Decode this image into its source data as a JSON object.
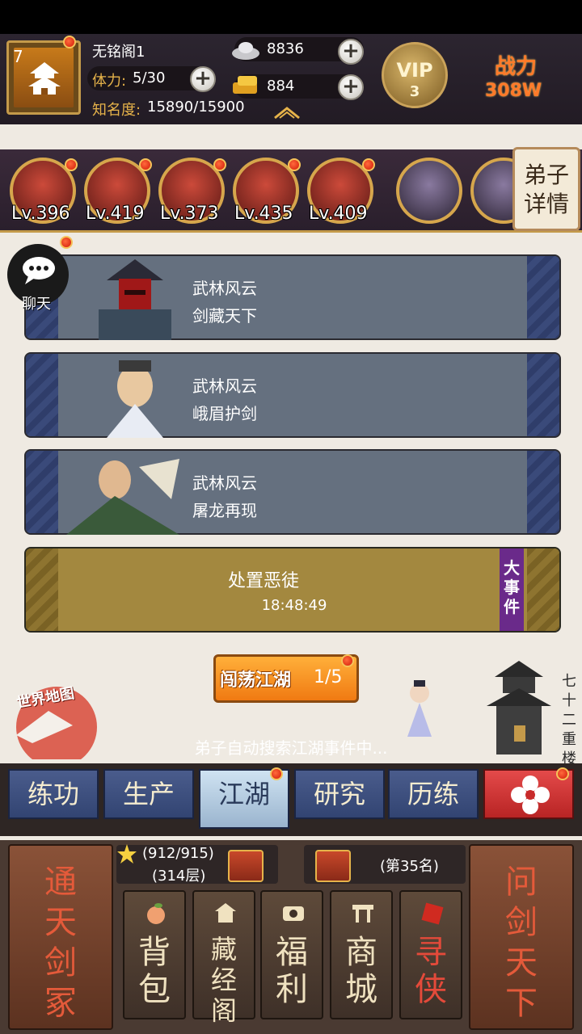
{
  "player": {
    "level": "7",
    "name": "无铭阁1",
    "stamina_label": "体力:",
    "stamina_value": "5/30",
    "fame_label": "知名度:",
    "fame_value": "15890/15900"
  },
  "currency": {
    "silver": "8836",
    "gold": "884"
  },
  "vip": {
    "label": "VIP",
    "level": "3"
  },
  "power": {
    "label": "战力",
    "value": "308W"
  },
  "disciples": [
    {
      "level": "Lv.396"
    },
    {
      "level": "Lv.419"
    },
    {
      "level": "Lv.373"
    },
    {
      "level": "Lv.435"
    },
    {
      "level": "Lv.409"
    }
  ],
  "disciple_detail_label": "弟子详情",
  "chat_label": "聊天",
  "events": [
    {
      "title": "武林风云",
      "subtitle": "剑藏天下"
    },
    {
      "title": "武林风云",
      "subtitle": "峨眉护剑"
    },
    {
      "title": "武林风云",
      "subtitle": "屠龙再现"
    }
  ],
  "big_event": {
    "title": "处置恶徒",
    "timer": "18:48:49",
    "tag": "大事件"
  },
  "wander": {
    "label": "闯荡江湖",
    "count": "1/5"
  },
  "world_map_label": "世界地图",
  "tower_label": "七十二重楼",
  "auto_search_text": "弟子自动搜索江湖事件中...",
  "tabs": [
    {
      "label": "练功"
    },
    {
      "label": "生产"
    },
    {
      "label": "江湖"
    },
    {
      "label": "研究"
    },
    {
      "label": "历练"
    }
  ],
  "bottom": {
    "left_big": "通天剑冢",
    "right_big": "问剑天下",
    "tower_progress": "(912/915)",
    "tower_floor": "(314层)",
    "rank": "(第35名)",
    "buttons": [
      {
        "label": "背包"
      },
      {
        "label": "藏经阁"
      },
      {
        "label": "福利"
      },
      {
        "label": "商城"
      },
      {
        "label": "寻侠"
      }
    ]
  },
  "colors": {
    "accent_gold": "#c49a4a",
    "power_orange": "#ff7a2a",
    "tab_blue": "#324472",
    "active_tab": "#cfe3f2"
  }
}
